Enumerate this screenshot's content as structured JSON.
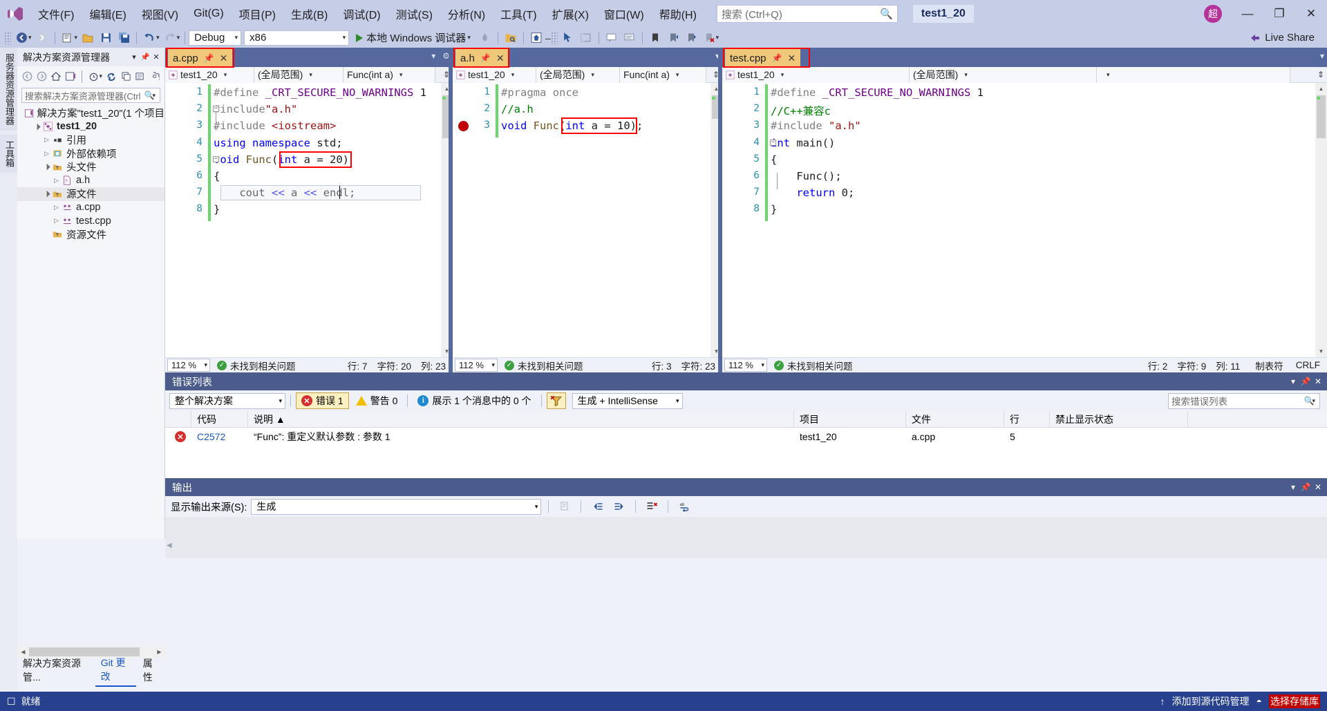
{
  "app": {
    "project_chip": "test1_20",
    "avatar_initial": "超"
  },
  "menu": {
    "items": [
      {
        "label": "文件(F)"
      },
      {
        "label": "编辑(E)"
      },
      {
        "label": "视图(V)"
      },
      {
        "label": "Git(G)"
      },
      {
        "label": "项目(P)"
      },
      {
        "label": "生成(B)"
      },
      {
        "label": "调试(D)"
      },
      {
        "label": "测试(S)"
      },
      {
        "label": "分析(N)"
      },
      {
        "label": "工具(T)"
      },
      {
        "label": "扩展(X)"
      },
      {
        "label": "窗口(W)"
      },
      {
        "label": "帮助(H)"
      }
    ],
    "search_placeholder": "搜索 (Ctrl+Q)",
    "search_icon": "search-icon"
  },
  "window_controls": {
    "minimize": "—",
    "maximize": "❐",
    "close": "✕"
  },
  "toolbar": {
    "config": "Debug",
    "platform": "x86",
    "run_label": "本地 Windows 调试器",
    "live_share": "Live Share"
  },
  "vertical_tabs": [
    {
      "label": "服务器资源管理器"
    },
    {
      "label": "工具箱"
    }
  ],
  "solution_explorer": {
    "title": "解决方案资源管理器",
    "search_placeholder": "搜索解决方案资源管理器(Ctrl",
    "tree": [
      {
        "label": "解决方案\"test1_20\"(1 个项目",
        "depth": 0,
        "arrow": "",
        "icon": "solution-icon",
        "bold": false
      },
      {
        "label": "test1_20",
        "depth": 1,
        "arrow": "▲",
        "icon": "project-icon",
        "bold": true
      },
      {
        "label": "引用",
        "depth": 2,
        "arrow": "▷",
        "icon": "references-icon",
        "bold": false
      },
      {
        "label": "外部依赖项",
        "depth": 2,
        "arrow": "▷",
        "icon": "ext-dep-icon",
        "bold": false
      },
      {
        "label": "头文件",
        "depth": 2,
        "arrow": "▲",
        "icon": "folder-icon",
        "bold": false
      },
      {
        "label": "a.h",
        "depth": 3,
        "arrow": "▷",
        "icon": "header-file-icon",
        "bold": false
      },
      {
        "label": "源文件",
        "depth": 2,
        "arrow": "▲",
        "icon": "folder-icon",
        "bold": false,
        "selected": true
      },
      {
        "label": "a.cpp",
        "depth": 3,
        "arrow": "▷",
        "icon": "cpp-file-icon",
        "bold": false
      },
      {
        "label": "test.cpp",
        "depth": 3,
        "arrow": "▷",
        "icon": "cpp-file-icon",
        "bold": false
      },
      {
        "label": "资源文件",
        "depth": 2,
        "arrow": "",
        "icon": "folder-icon",
        "bold": false
      }
    ],
    "bottom_tabs": [
      {
        "label": "解决方案资源管...",
        "active": false
      },
      {
        "label": "Git 更改",
        "active": true
      },
      {
        "label": "属性",
        "active": false
      }
    ]
  },
  "editors": [
    {
      "tab": "a.cpp",
      "tab_highlighted": true,
      "nav_project": "test1_20",
      "nav_scope": "(全局范围)",
      "nav_member": "Func(int a)",
      "lines": [
        {
          "n": 1,
          "segments": [
            {
              "t": "#define ",
              "c": "pp"
            },
            {
              "t": "_CRT_SECURE_NO_WARNINGS",
              "c": "mac"
            },
            {
              "t": " 1",
              "c": "num"
            }
          ]
        },
        {
          "n": 2,
          "segments": [
            {
              "t": "#include",
              "c": "pp"
            },
            {
              "t": "\"a.h\"",
              "c": "str"
            }
          ]
        },
        {
          "n": 3,
          "segments": [
            {
              "t": "#include ",
              "c": "pp"
            },
            {
              "t": "<iostream>",
              "c": "str"
            }
          ]
        },
        {
          "n": 4,
          "segments": [
            {
              "t": "using namespace ",
              "c": "kw"
            },
            {
              "t": "std;",
              "c": "idn"
            }
          ]
        },
        {
          "n": 5,
          "segments": [
            {
              "t": "void ",
              "c": "kw"
            },
            {
              "t": "Func",
              "c": "funcname"
            },
            {
              "t": "(",
              "c": "idn"
            },
            {
              "t": "int",
              "c": "kw"
            },
            {
              "t": " a = ",
              "c": "idn"
            },
            {
              "t": "20)",
              "c": "idn"
            }
          ]
        },
        {
          "n": 6,
          "segments": [
            {
              "t": "{",
              "c": "idn"
            }
          ]
        },
        {
          "n": 7,
          "segments": [
            {
              "t": "    cout ",
              "c": "idn"
            },
            {
              "t": "<<",
              "c": "kw"
            },
            {
              "t": " a ",
              "c": "idn"
            },
            {
              "t": "<<",
              "c": "kw"
            },
            {
              "t": " endl;",
              "c": "idn"
            }
          ]
        },
        {
          "n": 8,
          "segments": [
            {
              "t": "}",
              "c": "idn"
            }
          ]
        }
      ],
      "status": {
        "zoom": "112 %",
        "issues": "未找到相关问题",
        "row": "行: 7",
        "char": "字符: 20",
        "col": "列: 23"
      }
    },
    {
      "tab": "a.h",
      "tab_highlighted": true,
      "nav_project": "test1_20",
      "nav_scope": "(全局范围)",
      "nav_member": "Func(int a)",
      "lines": [
        {
          "n": 1,
          "segments": [
            {
              "t": "#pragma once",
              "c": "pp"
            }
          ]
        },
        {
          "n": 2,
          "segments": [
            {
              "t": "//a.h",
              "c": "cmt"
            }
          ]
        },
        {
          "n": 3,
          "segments": [
            {
              "t": "void ",
              "c": "kw"
            },
            {
              "t": "Func",
              "c": "funcname"
            },
            {
              "t": "(",
              "c": "idn"
            },
            {
              "t": "int",
              "c": "kw"
            },
            {
              "t": " a = ",
              "c": "idn"
            },
            {
              "t": "10);",
              "c": "idn"
            }
          ]
        }
      ],
      "breakpoint_line": 3,
      "status": {
        "zoom": "112 %",
        "issues": "未找到相关问题",
        "row": "行: 3",
        "char": "字符: 23",
        "col": ""
      }
    },
    {
      "tab": "test.cpp",
      "tab_highlighted": true,
      "nav_project": "test1_20",
      "nav_scope": "(全局范围)",
      "nav_member": "",
      "lines": [
        {
          "n": 1,
          "segments": [
            {
              "t": "#define ",
              "c": "pp"
            },
            {
              "t": "_CRT_SECURE_NO_WARNINGS",
              "c": "mac"
            },
            {
              "t": " 1",
              "c": "num"
            }
          ]
        },
        {
          "n": 2,
          "segments": [
            {
              "t": "//C++兼容c",
              "c": "cmt"
            }
          ]
        },
        {
          "n": 3,
          "segments": [
            {
              "t": "#include ",
              "c": "pp"
            },
            {
              "t": "\"a.h\"",
              "c": "str"
            }
          ]
        },
        {
          "n": 4,
          "segments": [
            {
              "t": "int ",
              "c": "kw"
            },
            {
              "t": "main()",
              "c": "idn"
            }
          ]
        },
        {
          "n": 5,
          "segments": [
            {
              "t": "{",
              "c": "idn"
            }
          ]
        },
        {
          "n": 6,
          "segments": [
            {
              "t": "    Func();",
              "c": "idn"
            }
          ]
        },
        {
          "n": 7,
          "segments": [
            {
              "t": "    ",
              "c": "idn"
            },
            {
              "t": "return",
              "c": "kw"
            },
            {
              "t": " 0;",
              "c": "idn"
            }
          ]
        },
        {
          "n": 8,
          "segments": [
            {
              "t": "}",
              "c": "idn"
            }
          ]
        }
      ],
      "status": {
        "zoom": "112 %",
        "issues": "未找到相关问题",
        "row": "行: 2",
        "char": "字符: 9",
        "col": "列: 11",
        "extra": "制表符",
        "eol": "CRLF"
      }
    }
  ],
  "error_list": {
    "title": "错误列表",
    "scope": "整个解决方案",
    "errors_label": "错误 1",
    "warnings_label": "警告 0",
    "messages_label": "展示 1 个消息中的 0 个",
    "filter_icon": "filter-icon",
    "source": "生成 + IntelliSense",
    "search_placeholder": "搜索错误列表",
    "columns": [
      "",
      "代码",
      "说明 ▲",
      "项目",
      "文件",
      "行",
      "禁止显示状态"
    ],
    "rows": [
      {
        "icon": "error-icon",
        "code": "C2572",
        "description": "“Func”: 重定义默认参数 : 参数 1",
        "project": "test1_20",
        "file": "a.cpp",
        "line": "5",
        "suppression": ""
      }
    ]
  },
  "output": {
    "title": "输出",
    "source_label": "显示输出来源(S):",
    "source_value": "生成"
  },
  "status_bar": {
    "ready": "就绪",
    "right_text": "添加到源代码管理",
    "right_sub": "选择存储库"
  },
  "colors": {
    "accent": "#27418e",
    "tab_active": "#f0c87a",
    "highlight_box": "#ff0000",
    "error": "#d32f2f",
    "menu_bg": "#c5cde7"
  }
}
